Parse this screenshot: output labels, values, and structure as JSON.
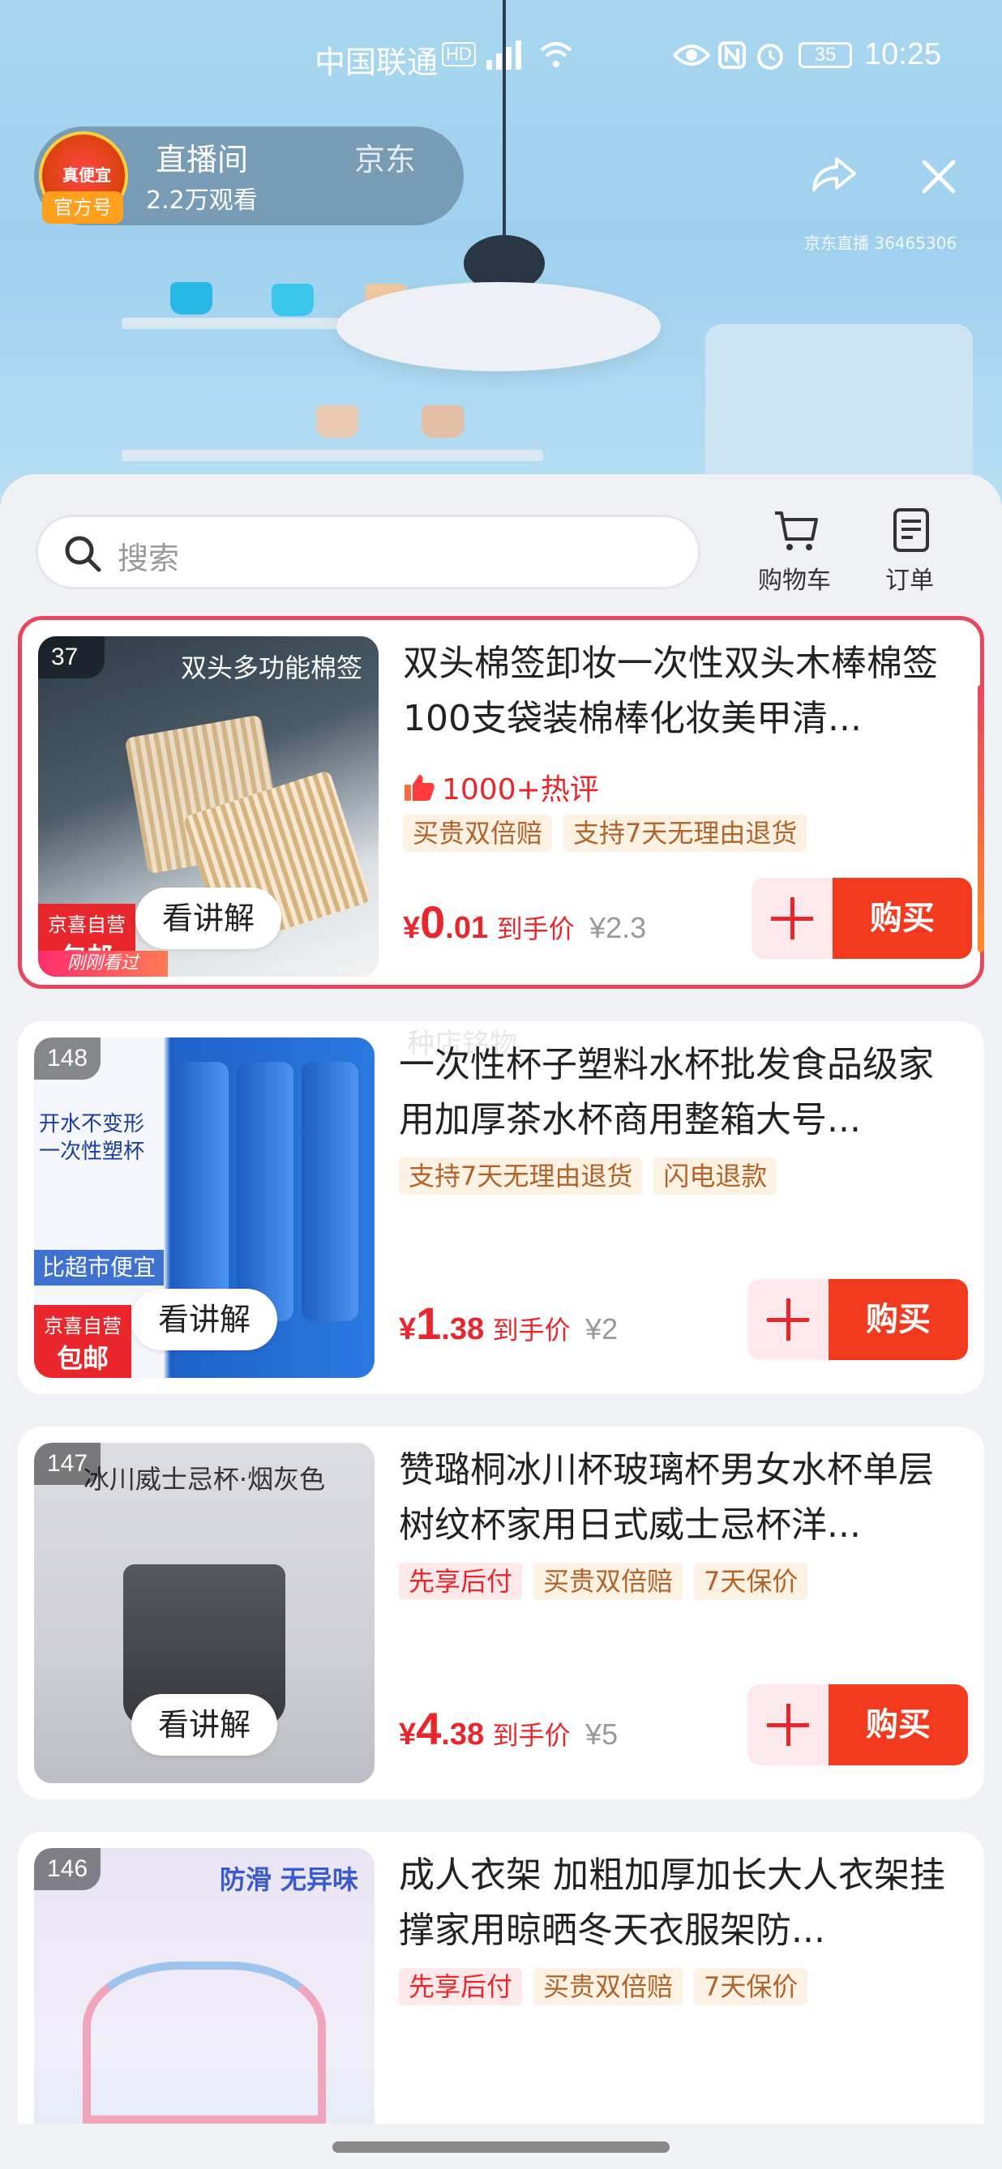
{
  "status_bar": {
    "carrier": "中国联通",
    "hd": "HD",
    "battery": "35",
    "time": "10:25"
  },
  "host": {
    "avatar_text": "真便宜",
    "badge": "官方号",
    "name": "直播间",
    "name2": "京东",
    "viewers": "2.2万观看",
    "room_id": "京东直播 36465306"
  },
  "search": {
    "placeholder": "搜索"
  },
  "toolbar": {
    "cart_label": "购物车",
    "order_label": "订单"
  },
  "products": [
    {
      "num": "37",
      "image_banner": "双头多功能棉签",
      "title": "双头棉签卸妆一次性双头木棒棉签100支袋装棉棒化妆美甲清...",
      "hot": "1000+热评",
      "tags": [
        "买贵双倍赔",
        "支持7天无理由退货"
      ],
      "price_currency": "¥",
      "price_int": "0",
      "price_dec": ".01",
      "price_label": "到手价",
      "price_original": "¥2.3",
      "explain": "看讲解",
      "jd_badge_a": "京喜自营",
      "jd_badge_b": "包邮",
      "just_watched": "刚刚看过",
      "add": "+",
      "buy": "购买"
    },
    {
      "num": "148",
      "image_banner": "开水不变形 一次性塑杯",
      "cheaper": "比超市便宜",
      "title": "一次性杯子塑料水杯批发食品级家用加厚茶水杯商用整箱大号...",
      "tags": [
        "支持7天无理由退货",
        "闪电退款"
      ],
      "price_currency": "¥",
      "price_int": "1",
      "price_dec": ".38",
      "price_label": "到手价",
      "price_original": "¥2",
      "explain": "看讲解",
      "jd_badge_a": "京喜自营",
      "jd_badge_b": "包邮",
      "watermark": "种店铭物",
      "buy": "购买"
    },
    {
      "num": "147",
      "image_banner": "冰川威士忌杯·烟灰色",
      "title": "赞璐桐冰川杯玻璃杯男女水杯单层树纹杯家用日式威士忌杯洋...",
      "tags": [
        "先享后付",
        "买贵双倍赔",
        "7天保价"
      ],
      "tag_red": [
        true,
        false,
        false
      ],
      "price_currency": "¥",
      "price_int": "4",
      "price_dec": ".38",
      "price_label": "到手价",
      "price_original": "¥5",
      "explain": "看讲解",
      "buy": "购买"
    },
    {
      "num": "146",
      "image_banner": "防滑 无异味",
      "title": "成人衣架 加粗加厚加长大人衣架挂撑家用晾晒冬天衣服架防...",
      "tags": [
        "先享后付",
        "买贵双倍赔",
        "7天保价"
      ],
      "tag_red": [
        true,
        false,
        false
      ]
    }
  ],
  "colors": {
    "accent": "#e8262c",
    "buy": "#f23a1f",
    "tag_bg": "#fdf1e4",
    "tag_text": "#b0642a"
  }
}
